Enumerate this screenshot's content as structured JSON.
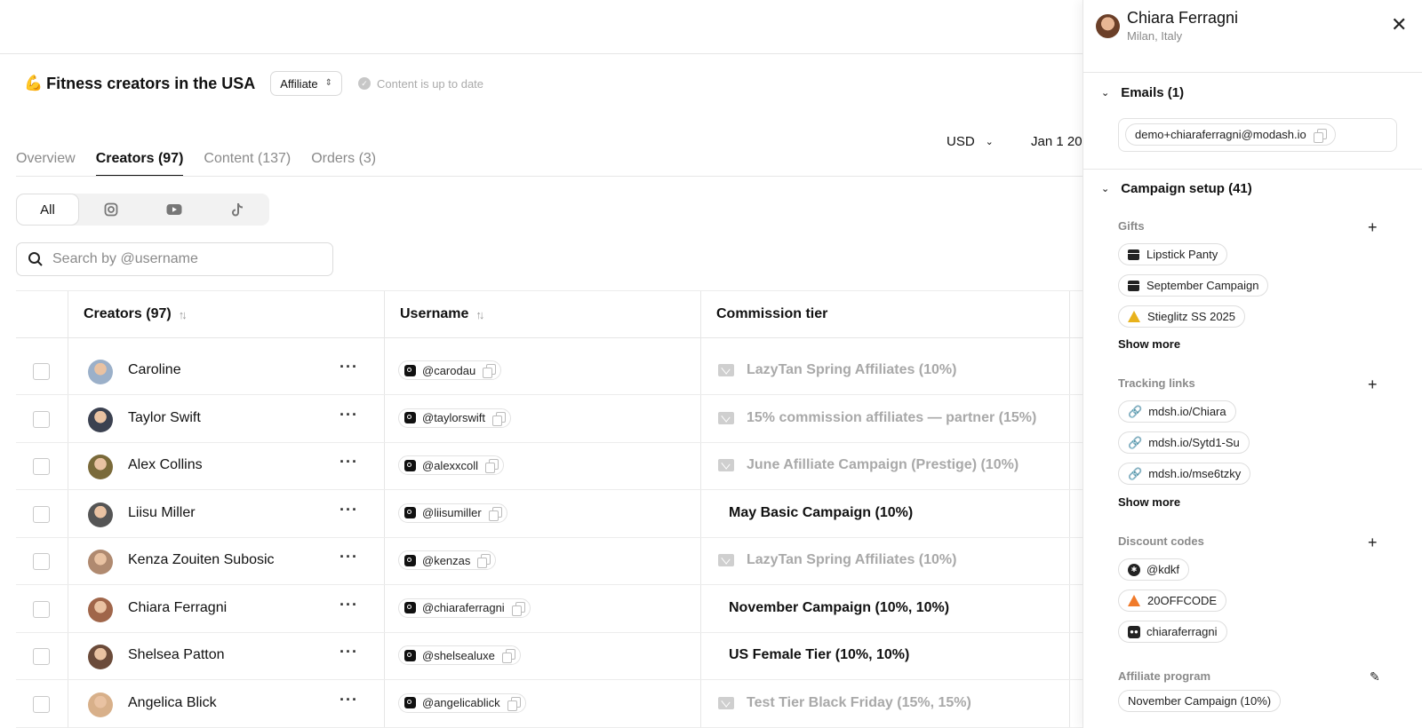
{
  "header": {
    "emoji": "💪",
    "title": "Fitness creators in the USA",
    "program_type": "Affiliate",
    "status_text": "Content is up to date"
  },
  "tabs": [
    {
      "label": "Overview",
      "active": false
    },
    {
      "label": "Creators (97)",
      "active": true
    },
    {
      "label": "Content (137)",
      "active": false
    },
    {
      "label": "Orders (3)",
      "active": false
    }
  ],
  "toolbar": {
    "currency": "USD",
    "date_range": "Jan 1 20"
  },
  "platform_filter": {
    "all_label": "All",
    "icons": [
      "instagram-icon",
      "youtube-icon",
      "tiktok-icon"
    ]
  },
  "search": {
    "placeholder": "Search by @username"
  },
  "table": {
    "columns": {
      "creators": "Creators (97)",
      "username": "Username",
      "commission": "Commission tier"
    },
    "rows": [
      {
        "name": "Caroline",
        "username": "@carodau",
        "tier": "LazyTan Spring Affiliates (10%)",
        "tier_muted": true,
        "avatar_color": "#9bb0c9"
      },
      {
        "name": "Taylor Swift",
        "username": "@taylorswift",
        "tier": "15% commission affiliates — partner (15%)",
        "tier_muted": true,
        "avatar_color": "#3b4150"
      },
      {
        "name": "Alex Collins",
        "username": "@alexxcoll",
        "tier": "June Afilliate Campaign (Prestige) (10%)",
        "tier_muted": true,
        "avatar_color": "#7a6a3a"
      },
      {
        "name": "Liisu Miller",
        "username": "@liisumiller",
        "tier": "May Basic Campaign (10%)",
        "tier_muted": false,
        "avatar_color": "#555555"
      },
      {
        "name": "Kenza Zouiten Subosic",
        "username": "@kenzas",
        "tier": "LazyTan Spring Affiliates (10%)",
        "tier_muted": true,
        "avatar_color": "#b08a70"
      },
      {
        "name": "Chiara Ferragni",
        "username": "@chiaraferragni",
        "tier": "November Campaign (10%, 10%)",
        "tier_muted": false,
        "avatar_color": "#a0664a"
      },
      {
        "name": "Shelsea Patton",
        "username": "@shelsealuxe",
        "tier": "US Female Tier (10%, 10%)",
        "tier_muted": false,
        "avatar_color": "#6b4b3a"
      },
      {
        "name": "Angelica Blick",
        "username": "@angelicablick",
        "tier": "Test Tier Black Friday (15%, 15%)",
        "tier_muted": true,
        "avatar_color": "#d8b08a"
      }
    ]
  },
  "panel": {
    "name": "Chiara Ferragni",
    "location": "Milan, Italy",
    "emails_title": "Emails (1)",
    "email": "demo+chiaraferragni@modash.io",
    "campaign_title": "Campaign setup (41)",
    "gifts_label": "Gifts",
    "gifts": [
      "Lipstick Panty",
      "September Campaign",
      "Stieglitz SS 2025"
    ],
    "tracking_label": "Tracking links",
    "tracking_links": [
      "mdsh.io/Chiara",
      "mdsh.io/Sytd1-Su",
      "mdsh.io/mse6tzky"
    ],
    "show_more": "Show more",
    "discount_label": "Discount codes",
    "discount_codes": [
      "@kdkf",
      "20OFFCODE",
      "chiaraferragni"
    ],
    "affiliate_label": "Affiliate program",
    "affiliate_program": "November Campaign (10%)"
  },
  "colors": {
    "warning": "#e8b21c",
    "warning_orange": "#f07a2a",
    "muted_text": "#a9a9a9"
  }
}
